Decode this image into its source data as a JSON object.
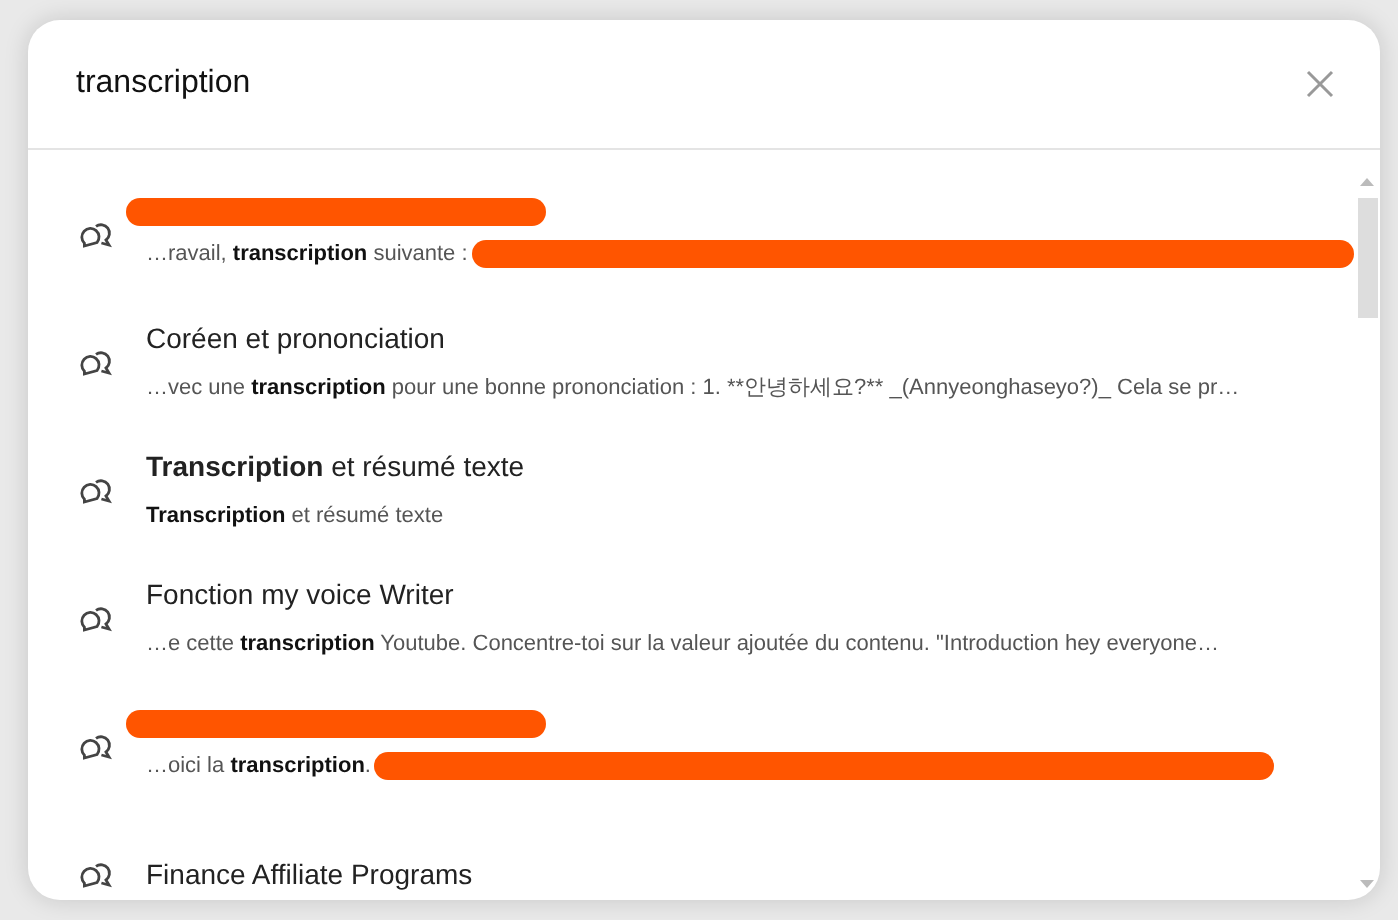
{
  "search": {
    "value": "transcription"
  },
  "results": [
    {
      "title_redacted": true,
      "snippet": [
        {
          "text": "…ravail, ",
          "bold": false
        },
        {
          "text": "transcription",
          "bold": true
        },
        {
          "text": " suivante :",
          "bold": false
        }
      ],
      "snippet_redacted": true
    },
    {
      "title": "Coréen et prononciation",
      "title_redacted": false,
      "snippet": [
        {
          "text": "…vec une ",
          "bold": false
        },
        {
          "text": "transcription",
          "bold": true
        },
        {
          "text": " pour une bonne prononciation : 1. **안녕하세요?** _(Annyeonghaseyo?)_ Cela se pr…",
          "bold": false
        }
      ],
      "snippet_redacted": false
    },
    {
      "title": "**Transcription** et résumé texte",
      "title_redacted": false,
      "snippet": [
        {
          "text": "Transcription",
          "bold": true
        },
        {
          "text": " et résumé texte",
          "bold": false
        }
      ],
      "snippet_redacted": false
    },
    {
      "title": "Fonction my voice Writer",
      "title_redacted": false,
      "snippet": [
        {
          "text": "…e cette ",
          "bold": false
        },
        {
          "text": "transcription",
          "bold": true
        },
        {
          "text": " Youtube. Concentre-toi sur la valeur ajoutée du contenu. \"Introduction hey everyone…",
          "bold": false
        }
      ],
      "snippet_redacted": false
    },
    {
      "title_redacted": true,
      "snippet": [
        {
          "text": "…oici la ",
          "bold": false
        },
        {
          "text": "transcription",
          "bold": true
        },
        {
          "text": ".",
          "bold": false
        }
      ],
      "snippet_redacted": true
    },
    {
      "title": "Finance Affiliate Programs",
      "title_redacted": false,
      "snippet_redacted": false
    }
  ]
}
